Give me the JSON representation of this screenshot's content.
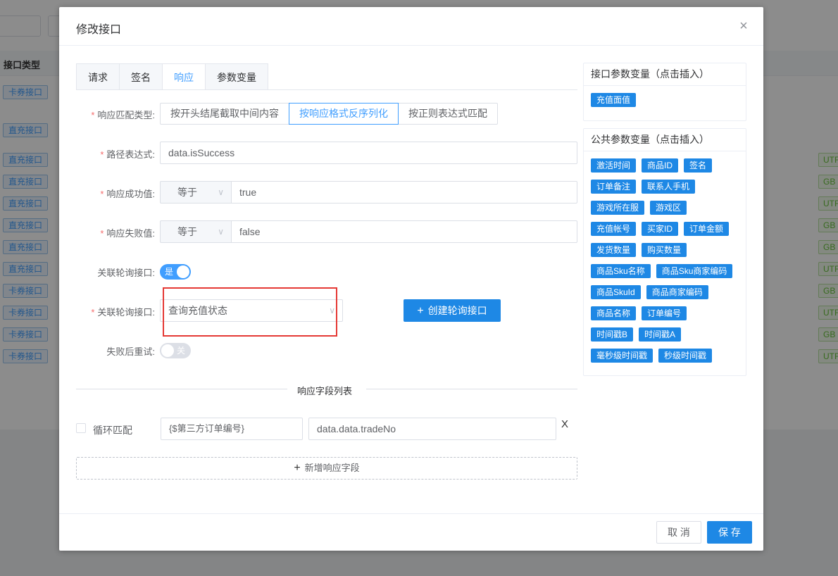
{
  "background": {
    "column_header": "接口类型",
    "row_tags": [
      "卡券接口",
      "直充接口",
      "直充接口",
      "直充接口",
      "直充接口",
      "直充接口",
      "直充接口",
      "直充接口",
      "卡券接口",
      "卡券接口",
      "卡券接口",
      "卡券接口"
    ],
    "right_tags": [
      "UTF",
      "GB",
      "UTF",
      "GB",
      "GB",
      "UTF",
      "GB",
      "UTF",
      "GB",
      "UTF"
    ]
  },
  "dialog": {
    "title": "修改接口",
    "close_icon": "×",
    "tabs": [
      {
        "label": "请求",
        "active": false
      },
      {
        "label": "签名",
        "active": false
      },
      {
        "label": "响应",
        "active": true
      },
      {
        "label": "参数变量",
        "active": false
      }
    ],
    "form": {
      "match_type_label": "响应匹配类型:",
      "match_types": [
        "按开头结尾截取中间内容",
        "按响应格式反序列化",
        "按正则表达式匹配"
      ],
      "match_type_selected": "按响应格式反序列化",
      "path_label": "路径表达式:",
      "path_value": "data.isSuccess",
      "success_label": "响应成功值:",
      "success_op": "等于",
      "success_value": "true",
      "fail_label": "响应失败值:",
      "fail_op": "等于",
      "fail_value": "false",
      "poll_switch_label": "关联轮询接口:",
      "poll_switch_text": "是",
      "poll_select_label": "关联轮询接口:",
      "poll_select_value": "查询充值状态",
      "create_poll_button": "创建轮询接口",
      "retry_label": "失败后重试:",
      "retry_switch_text": "关"
    },
    "fields_section": {
      "title": "响应字段列表",
      "loop_label": "循环匹配",
      "field_name": "{$第三方订单编号}",
      "field_path": "data.data.tradeNo",
      "delete_icon": "X",
      "add_button": "新增响应字段"
    },
    "right_panel": {
      "interface_vars_title": "接口参数变量（点击插入）",
      "interface_vars": [
        "充值面值"
      ],
      "public_vars_title": "公共参数变量（点击插入）",
      "public_vars": [
        "激活时间",
        "商品ID",
        "签名",
        "订单备注",
        "联系人手机",
        "游戏所在服",
        "游戏区",
        "充值帐号",
        "买家ID",
        "订单金额",
        "发货数量",
        "购买数量",
        "商品Sku名称",
        "商品Sku商家编码",
        "商品SkuId",
        "商品商家编码",
        "商品名称",
        "订单编号",
        "时间戳B",
        "时间戳A",
        "毫秒级时间戳",
        "秒级时间戳"
      ]
    },
    "footer": {
      "cancel": "取 消",
      "save": "保 存"
    }
  },
  "colors": {
    "primary": "#1e88e5",
    "active_tab": "#409eff",
    "required": "#f56c6c",
    "highlight_box": "#e53935"
  }
}
